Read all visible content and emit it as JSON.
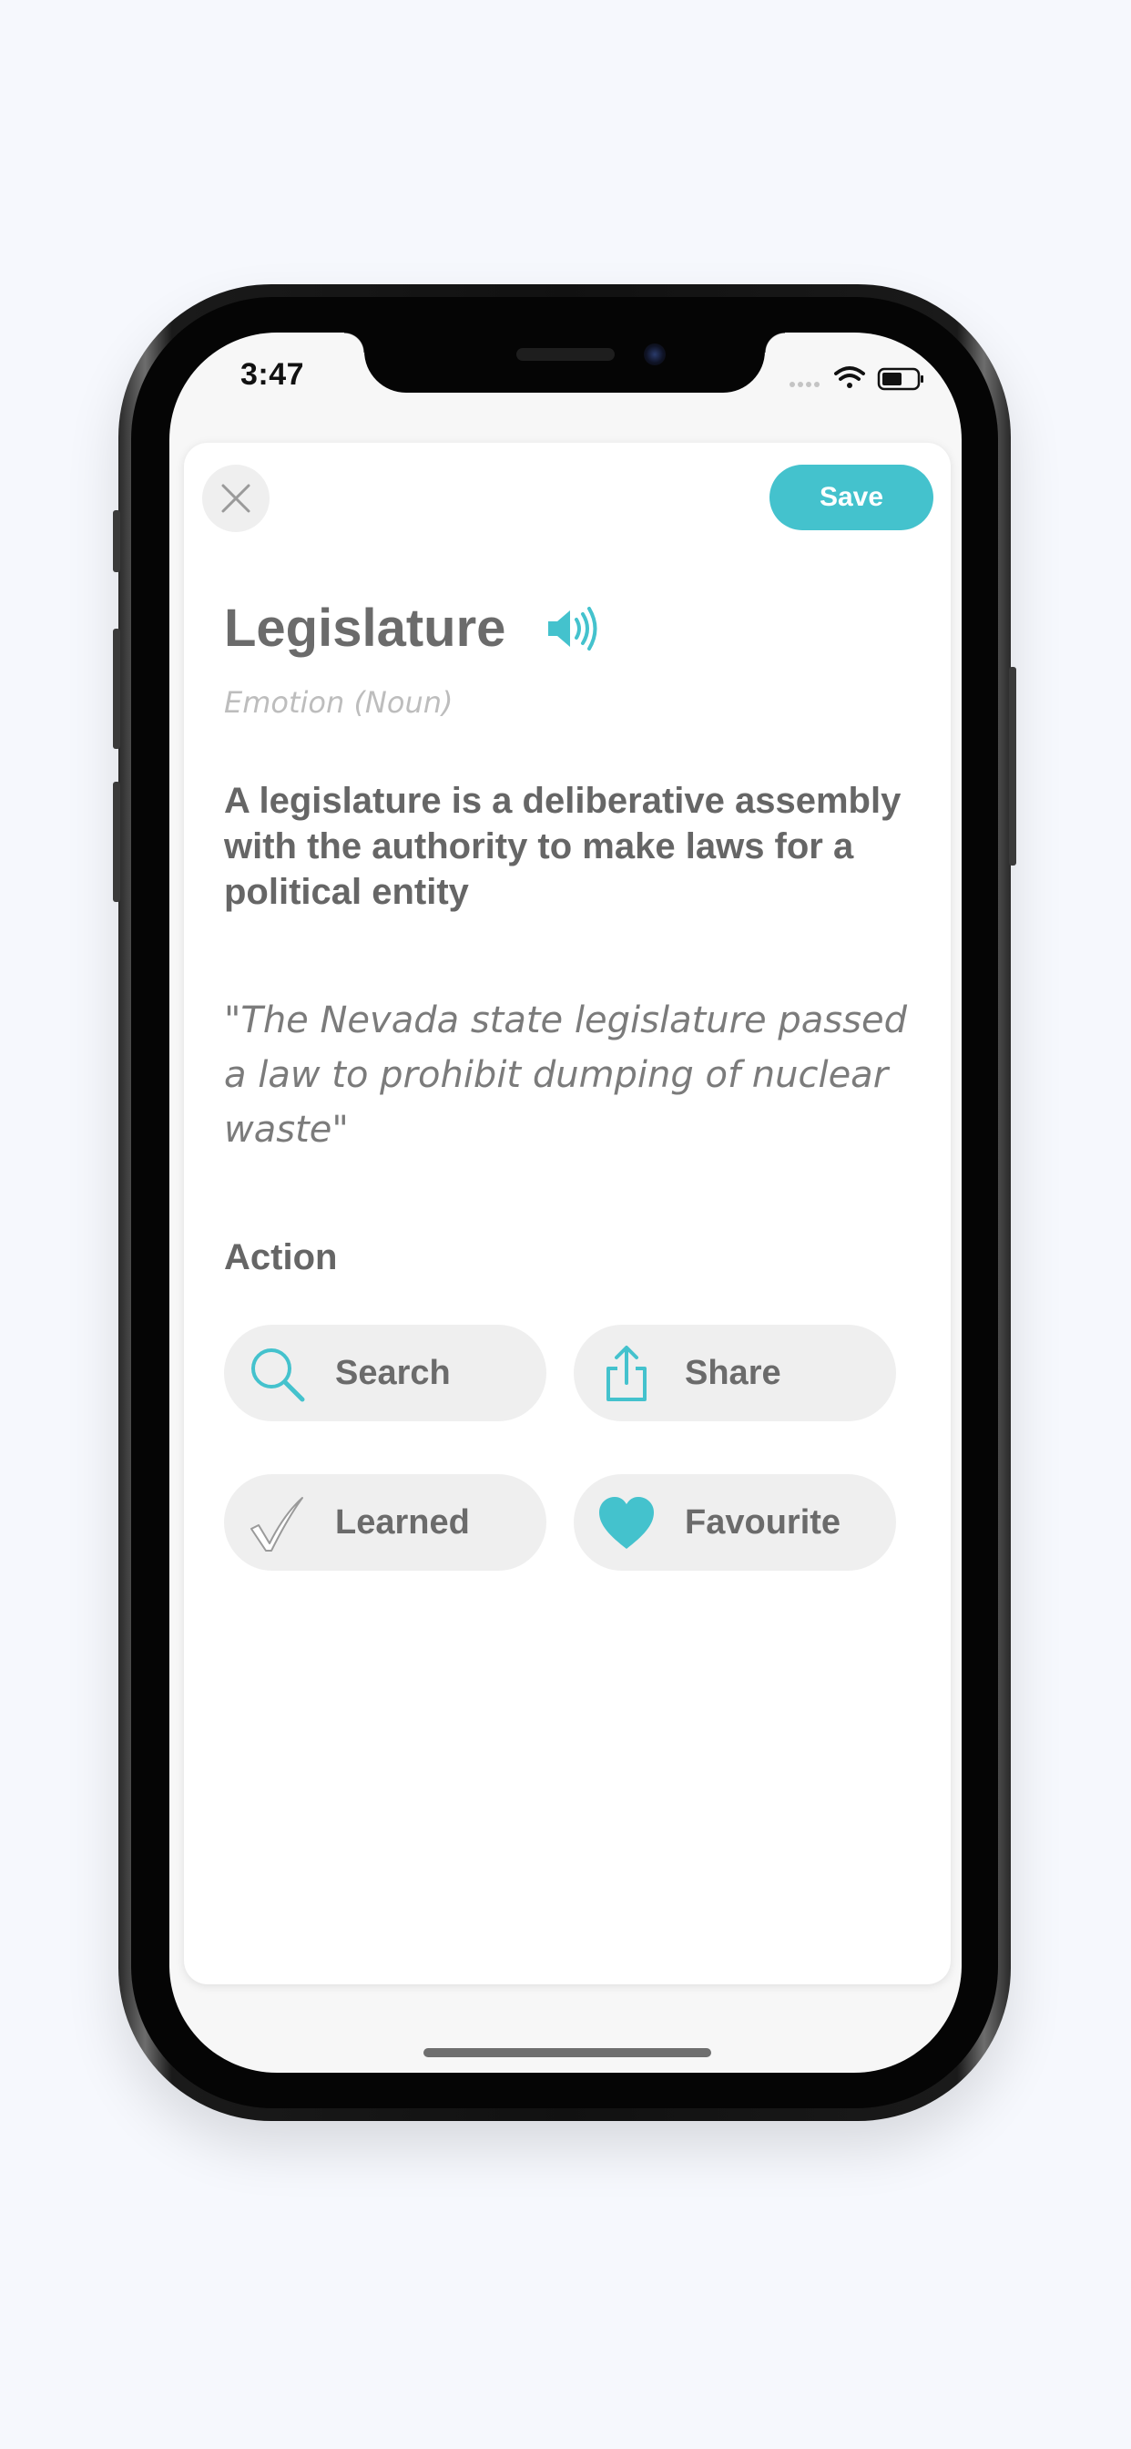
{
  "status_bar": {
    "time": "3:47"
  },
  "card": {
    "save_label": "Save",
    "word": "Legislature",
    "part_of_speech": "Emotion (Noun)",
    "definition": "A legislature is a deliberative assembly with the authority to make laws for a political entity",
    "example": " \"The Nevada state legislature passed a law to prohibit dumping of nuclear waste\"",
    "action_heading": "Action",
    "actions": [
      {
        "label": "Search",
        "icon": "search-icon"
      },
      {
        "label": "Share",
        "icon": "share-icon"
      },
      {
        "label": "Learned",
        "icon": "checkmark-icon"
      },
      {
        "label": "Favourite",
        "icon": "heart-icon"
      }
    ]
  },
  "colors": {
    "accent": "#44c2cd",
    "background": "#f6f8fd",
    "text": "#6b6b6b"
  }
}
